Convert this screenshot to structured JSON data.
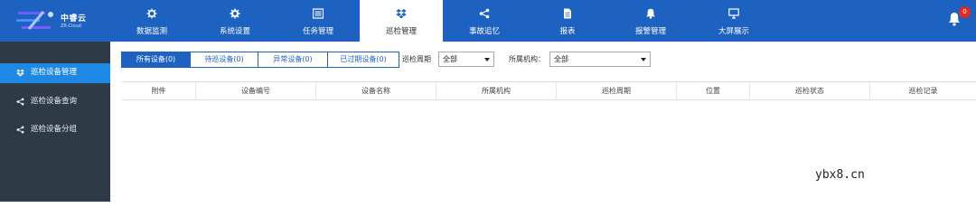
{
  "brand": {
    "name": "中睿云",
    "sub": "ZR-Cloud"
  },
  "nav": {
    "items": [
      {
        "label": "数据监测",
        "icon": "gear-cluster-icon"
      },
      {
        "label": "系统设置",
        "icon": "gear-icon"
      },
      {
        "label": "任务管理",
        "icon": "list-icon"
      },
      {
        "label": "巡检管理",
        "icon": "dropbox-icon",
        "active": true
      },
      {
        "label": "事故追忆",
        "icon": "share-icon"
      },
      {
        "label": "报表",
        "icon": "file-icon"
      },
      {
        "label": "报警管理",
        "icon": "bell-icon"
      },
      {
        "label": "大屏展示",
        "icon": "monitor-icon"
      }
    ],
    "notifications": {
      "count": "0",
      "icon": "bell-icon"
    }
  },
  "sidebar": {
    "items": [
      {
        "label": "巡检设备管理",
        "icon": "dropbox-icon",
        "active": true
      },
      {
        "label": "巡检设备查询",
        "icon": "share-icon"
      },
      {
        "label": "巡检设备分组",
        "icon": "share-icon"
      }
    ]
  },
  "tabs": [
    {
      "label": "所有设备(0)",
      "active": true
    },
    {
      "label": "待巡设备(0)"
    },
    {
      "label": "异常设备(0)"
    },
    {
      "label": "已过期设备(0)"
    }
  ],
  "filters": {
    "period": {
      "label": "巡检周期",
      "value": "全部"
    },
    "org": {
      "label": "所属机构：",
      "value": "全部"
    }
  },
  "table": {
    "columns": [
      "附件",
      "设备编号",
      "设备名称",
      "所属机构",
      "巡检周期",
      "位置",
      "巡检状态",
      "巡检记录"
    ]
  },
  "watermark": "ybx8.cn",
  "colors": {
    "header": "#1d62c0",
    "sidebar": "#2f3a47",
    "sidebar_active": "#1e88e5",
    "badge": "#e02b27"
  }
}
